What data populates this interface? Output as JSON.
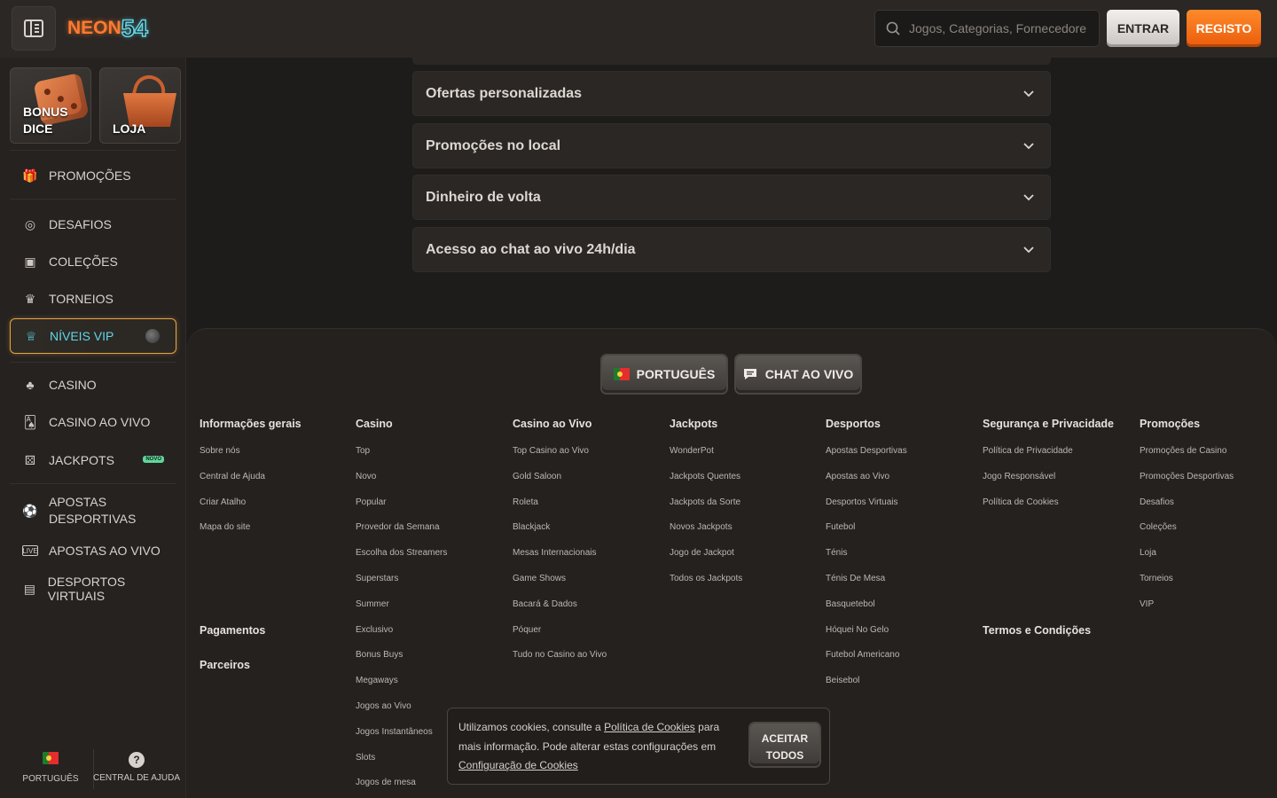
{
  "header": {
    "logo_text": "NEON",
    "logo_number": "54",
    "search_placeholder": "Jogos, Categorias, Fornecedores",
    "login_label": "ENTRAR",
    "register_label": "REGISTO"
  },
  "sidebar": {
    "tiles": [
      {
        "label_line1": "BONUS",
        "label_line2": "DICE"
      },
      {
        "label_line1": "LOJA",
        "label_line2": ""
      }
    ],
    "items": [
      {
        "label": "PROMOÇÕES",
        "icon": "gift-icon"
      },
      {
        "label": "DESAFIOS",
        "icon": "badge-icon"
      },
      {
        "label": "COLEÇÕES",
        "icon": "collection-icon"
      },
      {
        "label": "TORNEIOS",
        "icon": "trophy-icon"
      },
      {
        "label": "NÍVEIS VIP",
        "icon": "crown-icon"
      },
      {
        "label": "CASINO",
        "icon": "clubs-icon"
      },
      {
        "label": "CASINO AO VIVO",
        "icon": "live-cards-icon"
      },
      {
        "label": "JACKPOTS",
        "icon": "dice-icon",
        "badge": "NOVO"
      },
      {
        "label_line1": "APOSTAS",
        "label_line2": "DESPORTIVAS",
        "icon": "soccer-icon"
      },
      {
        "label": "APOSTAS AO VIVO",
        "icon": "live-icon"
      },
      {
        "label": "DESPORTOS VIRTUAIS",
        "icon": "virtual-icon"
      }
    ],
    "footer": {
      "language_label": "PORTUGUÊS",
      "help_label": "CENTRAL DE AJUDA"
    }
  },
  "accordions": [
    "Ofertas personalizadas",
    "Promoções no local",
    "Dinheiro de volta",
    "Acesso ao chat ao vivo 24h/dia"
  ],
  "footer": {
    "language_button": "PORTUGUÊS",
    "chat_button": "CHAT AO VIVO",
    "columns": [
      {
        "title": "Informações gerais",
        "links": [
          "Sobre nós",
          "Central de Ajuda",
          "Criar Atalho",
          "Mapa do site"
        ]
      },
      {
        "title": "Casino",
        "links": [
          "Top",
          "Novo",
          "Popular",
          "Provedor da Semana",
          "Escolha dos Streamers",
          "Superstars",
          "Summer",
          "Exclusivo",
          "Bonus Buys",
          "Megaways",
          "Jogos ao Vivo",
          "Jogos Instantâneos",
          "Slots",
          "Jogos de mesa"
        ]
      },
      {
        "title": "Casino ao Vivo",
        "links": [
          "Top Casino ao Vivo",
          "Gold Saloon",
          "Roleta",
          "Blackjack",
          "Mesas Internacionais",
          "Game Shows",
          "Bacará & Dados",
          "Póquer",
          "Tudo no Casino ao Vivo"
        ]
      },
      {
        "title": "Jackpots",
        "links": [
          "WonderPot",
          "Jackpots Quentes",
          "Jackpots da Sorte",
          "Novos Jackpots",
          "Jogo de Jackpot",
          "Todos os Jackpots"
        ]
      },
      {
        "title": "Desportos",
        "links": [
          "Apostas Desportivas",
          "Apostas ao Vivo",
          "Desportos Virtuais",
          "Futebol",
          "Ténis",
          "Ténis De Mesa",
          "Basquetebol",
          "Hóquei No Gelo",
          "Futebol Americano",
          "Beisebol"
        ]
      },
      {
        "title": "Segurança e Privacidade",
        "links": [
          "Política de Privacidade",
          "Jogo Responsável",
          "Política de Cookies"
        ]
      },
      {
        "title": "Promoções",
        "links": [
          "Promoções de Casino",
          "Promoções Desportivas",
          "Desafios",
          "Coleções",
          "Loja",
          "Torneios",
          "VIP"
        ]
      }
    ],
    "payments": "Pagamentos",
    "partners": "Parceiros",
    "terms": "Termos e Condições"
  },
  "cookie": {
    "text_before": "Utilizamos cookies, consulte a ",
    "policy_link": "Política de Cookies",
    "text_after": " para mais informação. Pode alterar estas configurações em ",
    "settings_link": "Configuração de Cookies",
    "accept_line1": "ACEITAR",
    "accept_line2": "TODOS"
  },
  "colors": {
    "accent_orange": "#ea5c0c",
    "vip_cyan": "#5fd7e8",
    "vip_border": "#e7a542",
    "background": "#1e1c1a"
  }
}
